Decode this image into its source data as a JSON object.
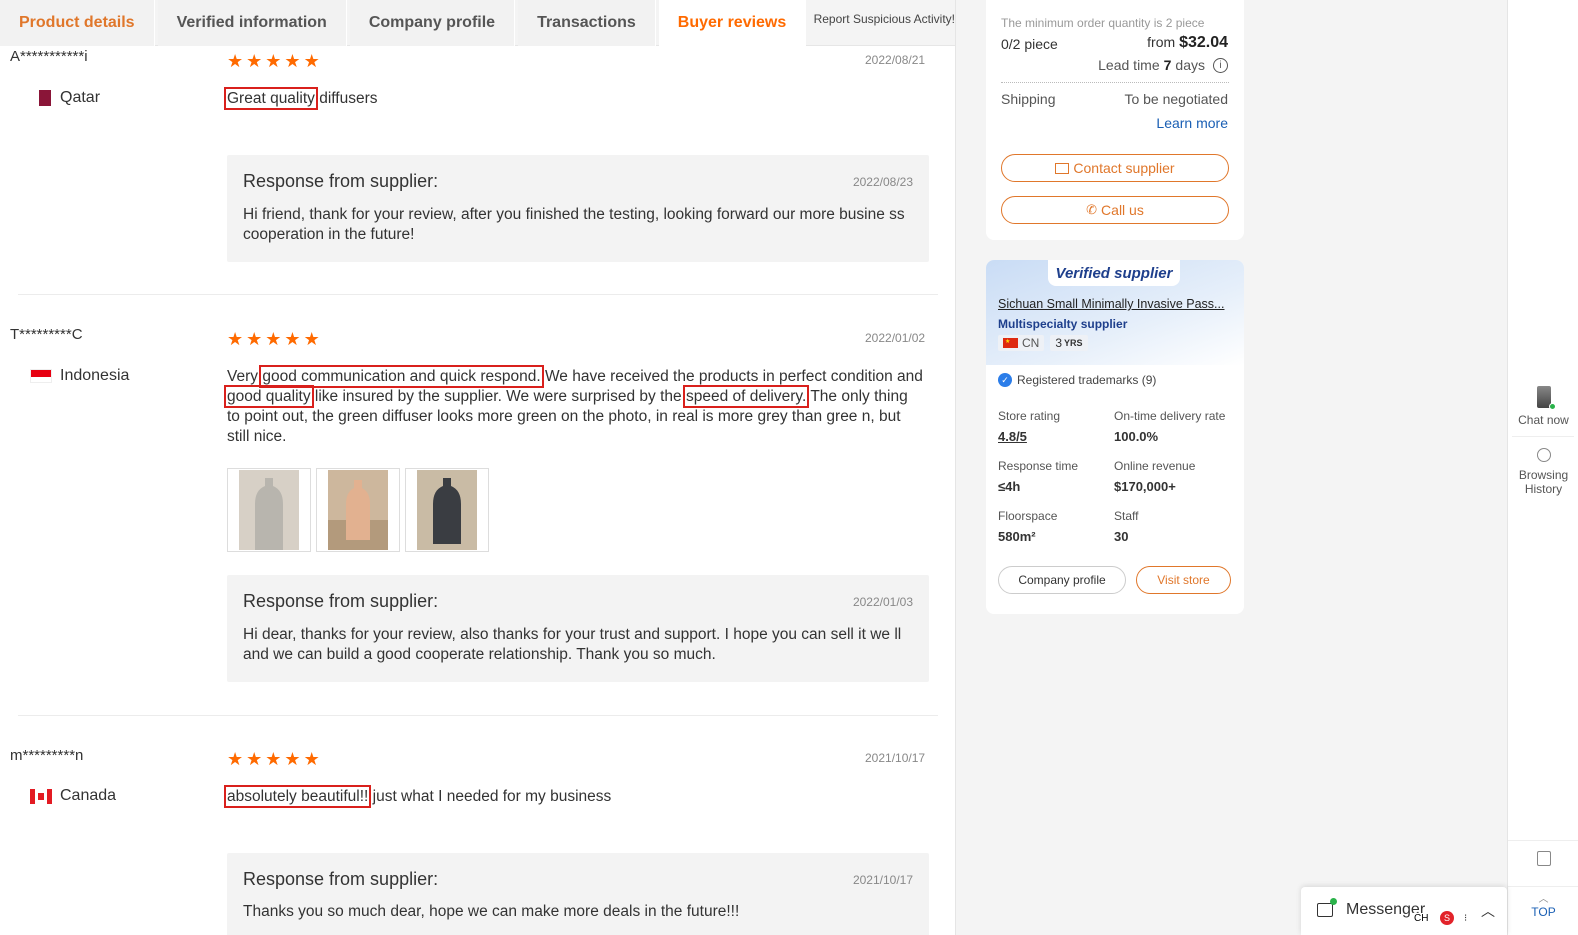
{
  "tabs": [
    {
      "label": "Product details"
    },
    {
      "label": "Verified information"
    },
    {
      "label": "Company profile"
    },
    {
      "label": "Transactions"
    },
    {
      "label": "Buyer reviews"
    }
  ],
  "report_link": "Report Suspicious Activity!",
  "reviews": [
    {
      "user": "A***********i",
      "country": "Qatar",
      "date": "2022/08/21",
      "comment_highlight_1": "Great quality",
      "comment_rest_1": " diffusers",
      "response_title": "Response from supplier:",
      "response_date": "2022/08/23",
      "response_text": "Hi friend, thank for your review, after you finished the testing, looking forward our more busine ss cooperation in the future!"
    },
    {
      "user": "T*********C",
      "country": "Indonesia",
      "date": "2022/01/02",
      "c_1": "Very ",
      "c_hl_1": "good communication and quick respond.",
      "c_2": " We have received the products in perfect condition and ",
      "c_hl_2": "good quality",
      "c_3": " like insured by the supplier. We were surprised by the ",
      "c_hl_3": "speed of delivery.",
      "c_4": " The only thing to point out, the green diffuser looks more green on the photo, in real is more grey than gree n, but still nice.",
      "response_title": "Response from supplier:",
      "response_date": "2022/01/03",
      "response_text": "Hi dear, thanks for your review, also thanks for your trust and support. I hope you can sell it we ll and we can build a good cooperate relationship. Thank you so much."
    },
    {
      "user": "m*********n",
      "country": "Canada",
      "date": "2021/10/17",
      "comment_highlight_1": "absolutely beautiful!!",
      "comment_rest_1": " just what I needed for my business",
      "response_title": "Response from supplier:",
      "response_date": "2021/10/17",
      "response_text": "Thanks you so much dear, hope we can make more deals in the future!!!"
    }
  ],
  "order_card": {
    "moq_note": "The minimum order quantity is 2 piece",
    "qty": "0/2 piece",
    "from_label": "from",
    "price": "$32.04",
    "lead_time_label": "Lead time",
    "lead_time_value": "7",
    "lead_time_unit": "days",
    "shipping_label": "Shipping",
    "shipping_value": "To be negotiated",
    "learn_more": "Learn more",
    "contact_supplier": "Contact supplier",
    "call_us": "Call us"
  },
  "supplier_card": {
    "badge": "Verified supplier",
    "name": "Sichuan Small Minimally Invasive Pass...",
    "type": "Multispecialty supplier",
    "country_code": "CN",
    "years": "3",
    "years_unit": "YRS",
    "trademarks": "Registered trademarks (9)",
    "stats": [
      {
        "label": "Store rating",
        "value": "4.8/5"
      },
      {
        "label": "On-time delivery rate",
        "value": "100.0%"
      },
      {
        "label": "Response time",
        "value": "≤4h"
      },
      {
        "label": "Online revenue",
        "value": "$170,000+"
      },
      {
        "label": "Floorspace",
        "value": "580m²"
      },
      {
        "label": "Staff",
        "value": "30"
      }
    ],
    "company_profile_btn": "Company profile",
    "visit_store_btn": "Visit store"
  },
  "rail": {
    "chat_now": "Chat now",
    "browsing_history_1": "Browsing",
    "browsing_history_2": "History",
    "top": "TOP"
  },
  "messenger": {
    "label": "Messenger",
    "ime": "CH"
  },
  "colors": {
    "accent": "#ff6a00",
    "highlight_box": "#d9201c",
    "link_blue": "#1a5fb4"
  }
}
